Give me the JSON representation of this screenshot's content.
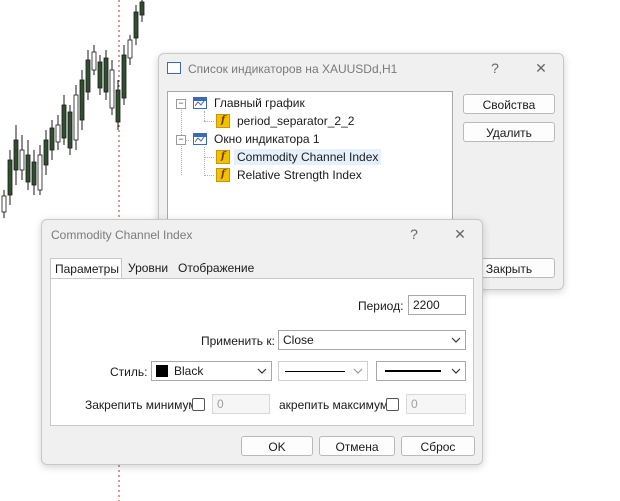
{
  "colors": {
    "dialog_bg": "#f0f0f0",
    "candle_up": "#1a1a1a",
    "candle_down": "#2f4f2f",
    "separator_line": "#b03030",
    "indicator_icon": "#f2c200"
  },
  "indicators_dialog": {
    "title": "Список индикаторов на XAUUSDd,H1",
    "help_label": "?",
    "close_label": "✕",
    "tree": [
      {
        "label": "Главный график",
        "icon": "chart-window-icon",
        "expanded": true
      },
      {
        "label": "period_separator_2_2",
        "icon": "indicator-icon"
      },
      {
        "label": "Окно индикатора 1",
        "icon": "chart-window-icon",
        "expanded": true
      },
      {
        "label": "Commodity Channel Index",
        "icon": "indicator-icon",
        "selected": true
      },
      {
        "label": "Relative Strength Index",
        "icon": "indicator-icon"
      }
    ],
    "buttons": {
      "properties": "Свойства",
      "delete": "Удалить",
      "close": "Закрыть"
    }
  },
  "cci_dialog": {
    "title": "Commodity Channel Index",
    "help_label": "?",
    "close_label": "✕",
    "tabs": [
      "Параметры",
      "Уровни",
      "Отображение"
    ],
    "active_tab": "Параметры",
    "period_label": "Период:",
    "period_value": "2200",
    "apply_label": "Применить к:",
    "apply_value": "Close",
    "style_label": "Стиль:",
    "style_color": "Black",
    "fix_min_label": "Закрепить минимум",
    "fix_min_value": "0",
    "fix_max_label": "акрепить максимум",
    "fix_max_value": "0",
    "buttons": {
      "ok": "OK",
      "cancel": "Отмена",
      "reset": "Сброс"
    }
  }
}
